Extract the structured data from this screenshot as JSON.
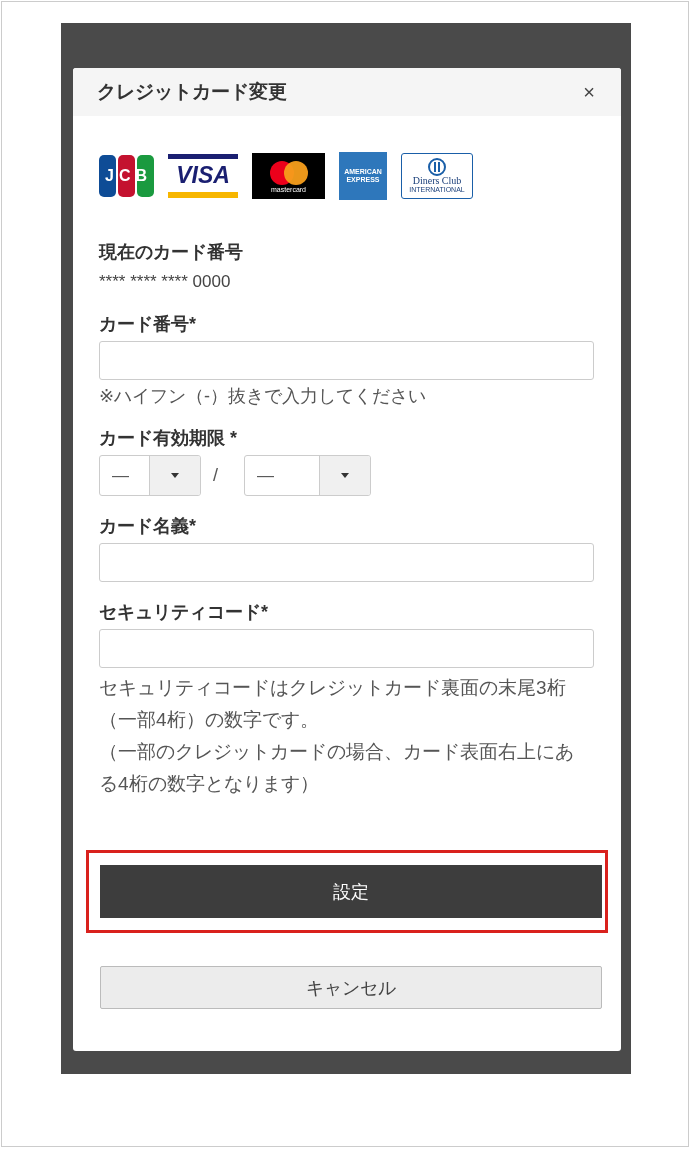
{
  "dialog": {
    "title": "クレジットカード変更",
    "close": "×"
  },
  "card_logos": [
    {
      "kind": "jcb",
      "label": "JCB"
    },
    {
      "kind": "visa",
      "label": "VISA"
    },
    {
      "kind": "mastercard",
      "label": "mastercard"
    },
    {
      "kind": "amex",
      "label": "AMERICAN EXPRESS"
    },
    {
      "kind": "diners",
      "label": "Diners Club",
      "sublabel": "INTERNATIONAL"
    }
  ],
  "current_card": {
    "label": "現在のカード番号",
    "value": "**** **** **** 0000"
  },
  "card_number": {
    "label": "カード番号*",
    "hint": "※ハイフン（-）抜きで入力してください"
  },
  "expiry": {
    "label": "カード有効期限 *",
    "month": "―",
    "separator": "/",
    "year": "―"
  },
  "card_name": {
    "label": "カード名義*"
  },
  "security_code": {
    "label": "セキュリティコード*",
    "notes": [
      "セキュリティコードはクレジットカード裏面の末尾3桁（一部4桁）の数字です。",
      "（一部のクレジットカードの場合、カード表面右上にある4桁の数字となります）"
    ]
  },
  "buttons": [
    {
      "kind": "primary",
      "label": "設定",
      "highlighted": true
    },
    {
      "kind": "secondary",
      "label": "キャンセル",
      "highlighted": false
    }
  ]
}
